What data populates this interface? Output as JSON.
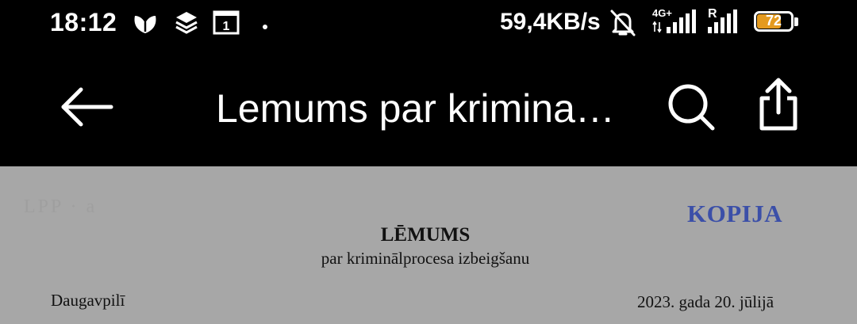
{
  "status_bar": {
    "time": "18:12",
    "net_speed": "59,4KB/s",
    "network_type": "4G+",
    "roaming": "R",
    "battery": "72",
    "battery_level": 0.72,
    "icons": [
      "app-notification-icon",
      "layers-icon",
      "calendar-1-icon",
      "dot-icon",
      "bell-off-icon",
      "signal-icon",
      "signal-roaming-icon",
      "battery-icon"
    ]
  },
  "app_bar": {
    "title": "Lemums par krimina…",
    "icons": [
      "back-arrow-icon",
      "search-icon",
      "share-icon"
    ]
  },
  "document": {
    "blur_text": "LPP · a",
    "stamp": "KOPIJA",
    "title": "LĒMUMS",
    "subtitle": "par kriminālprocesa izbeigšanu",
    "place": "Daugavpilī",
    "date": "2023. gada 20. jūlijā"
  },
  "colors": {
    "status_bg": "#000000",
    "doc_bg": "#a7a7a7",
    "stamp": "#3b4fa8",
    "battery_fill": "#e49a1f"
  }
}
